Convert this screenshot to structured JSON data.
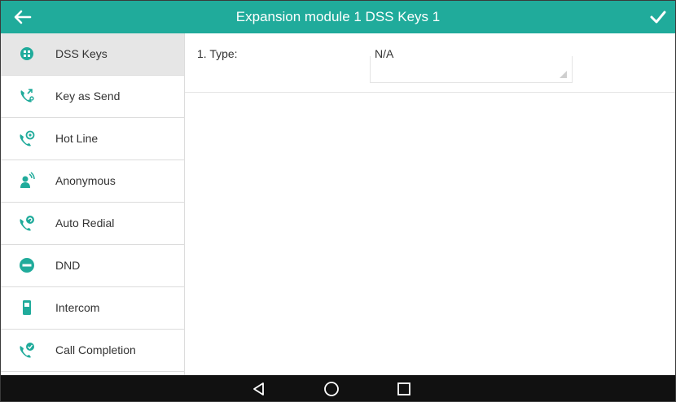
{
  "header": {
    "title": "Expansion module 1 DSS Keys 1",
    "back_icon": "back-arrow-icon",
    "confirm_icon": "checkmark-icon",
    "accent_color": "#20ab9b"
  },
  "sidebar": {
    "items": [
      {
        "label": "DSS Keys",
        "icon": "dss-keys-icon",
        "active": true
      },
      {
        "label": "Key as Send",
        "icon": "key-as-send-icon",
        "active": false
      },
      {
        "label": "Hot Line",
        "icon": "hot-line-icon",
        "active": false
      },
      {
        "label": "Anonymous",
        "icon": "anonymous-icon",
        "active": false
      },
      {
        "label": "Auto Redial",
        "icon": "auto-redial-icon",
        "active": false
      },
      {
        "label": "DND",
        "icon": "dnd-icon",
        "active": false
      },
      {
        "label": "Intercom",
        "icon": "intercom-icon",
        "active": false
      },
      {
        "label": "Call Completion",
        "icon": "call-completion-icon",
        "active": false
      }
    ]
  },
  "main": {
    "fields": [
      {
        "label": "1. Type:",
        "value": "N/A"
      }
    ]
  },
  "navbar": {
    "buttons": [
      "back-triangle-icon",
      "home-circle-icon",
      "recents-square-icon"
    ]
  }
}
